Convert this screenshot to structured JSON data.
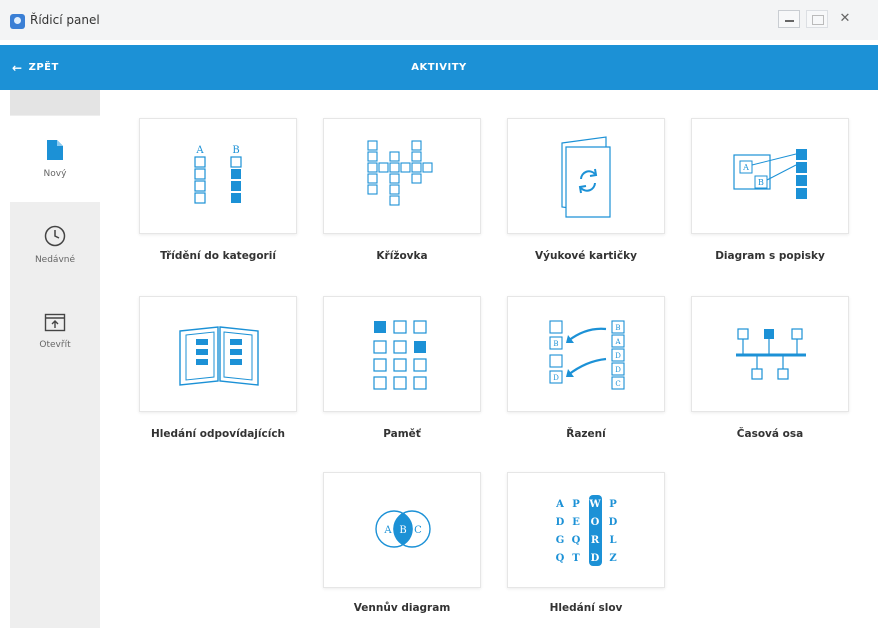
{
  "window": {
    "title": "Řídicí panel",
    "close_glyph": "✕"
  },
  "header": {
    "back_label": "ZPĚT",
    "back_arrow": "←",
    "title": "AKTIVITY"
  },
  "sidebar": {
    "items": [
      {
        "label": "Nový",
        "icon": "new-file-icon"
      },
      {
        "label": "Nedávné",
        "icon": "clock-icon"
      },
      {
        "label": "Otevřít",
        "icon": "open-folder-icon"
      }
    ]
  },
  "activities": [
    {
      "label": "Třídění do kategorií",
      "icon": "category-sort-icon"
    },
    {
      "label": "Křížovka",
      "icon": "crossword-icon"
    },
    {
      "label": "Výukové kartičky",
      "icon": "flashcards-icon"
    },
    {
      "label": "Diagram s popisky",
      "icon": "labelled-diagram-icon"
    },
    {
      "label": "Hledání odpovídajících",
      "icon": "matching-book-icon"
    },
    {
      "label": "Paměť",
      "icon": "memory-grid-icon"
    },
    {
      "label": "Řazení",
      "icon": "ordering-icon"
    },
    {
      "label": "Časová osa",
      "icon": "timeline-icon"
    },
    {
      "label": "Vennův diagram",
      "icon": "venn-diagram-icon"
    },
    {
      "label": "Hledání slov",
      "icon": "word-search-icon"
    }
  ],
  "icon_text": {
    "category_a": "A",
    "category_b": "B",
    "diagram_a": "A",
    "diagram_b": "B",
    "sort_a": "A",
    "sort_b": "B",
    "sort_c": "C",
    "sort_d": "D",
    "venn_a": "A",
    "venn_b": "B",
    "venn_c": "C",
    "wordsearch_rows": [
      [
        "A",
        "P",
        "W",
        "P"
      ],
      [
        "D",
        "E",
        "O",
        "D"
      ],
      [
        "G",
        "Q",
        "R",
        "L"
      ],
      [
        "Q",
        "T",
        "D",
        "Z"
      ]
    ]
  },
  "colors": {
    "accent": "#1c91d6",
    "icon": "#1c91d6",
    "sidebar": "#eeeeee"
  }
}
